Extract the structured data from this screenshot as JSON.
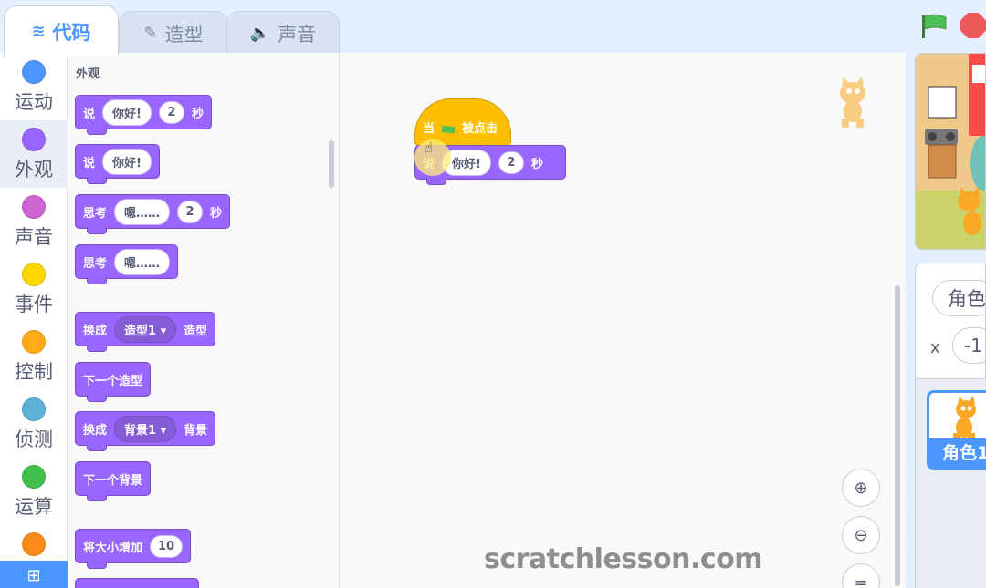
{
  "tabs": [
    {
      "label": "代码",
      "icon": "code-icon"
    },
    {
      "label": "造型",
      "icon": "brush-icon"
    },
    {
      "label": "声音",
      "icon": "speaker-icon"
    }
  ],
  "categories": [
    {
      "label": "运动",
      "color": "#4c97ff"
    },
    {
      "label": "外观",
      "color": "#9966ff"
    },
    {
      "label": "声音",
      "color": "#cf63cf"
    },
    {
      "label": "事件",
      "color": "#ffd500"
    },
    {
      "label": "控制",
      "color": "#ffab19"
    },
    {
      "label": "侦测",
      "color": "#5cb1d6"
    },
    {
      "label": "运算",
      "color": "#40bf4a"
    },
    {
      "label": "",
      "color": "#ff8c1a"
    }
  ],
  "palette": {
    "section_title": "外观",
    "blocks": [
      {
        "text1": "说",
        "input1": "你好!",
        "input2": "2",
        "text2": "秒"
      },
      {
        "text1": "说",
        "input1": "你好!"
      },
      {
        "text1": "思考",
        "input1": "嗯……",
        "input2": "2",
        "text2": "秒"
      },
      {
        "text1": "思考",
        "input1": "嗯……"
      },
      {
        "text1": "换成",
        "dropdown": "造型1 ▾",
        "text2": "造型"
      },
      {
        "text1": "下一个造型"
      },
      {
        "text1": "换成",
        "dropdown": "背景1 ▾",
        "text2": "背景"
      },
      {
        "text1": "下一个背景"
      },
      {
        "text1": "将大小增加",
        "input1": "10"
      }
    ]
  },
  "script": {
    "hat_text1": "当",
    "hat_text2": "被点击",
    "say_text": "说",
    "say_input": "你好!",
    "say_seconds": "2",
    "say_unit": "秒"
  },
  "watermark": "scratchlesson.com",
  "sprite_info": {
    "name_value": "角色",
    "x_label": "x",
    "x_value": "-1"
  },
  "sprite_list": {
    "tile_label": "角色1"
  }
}
